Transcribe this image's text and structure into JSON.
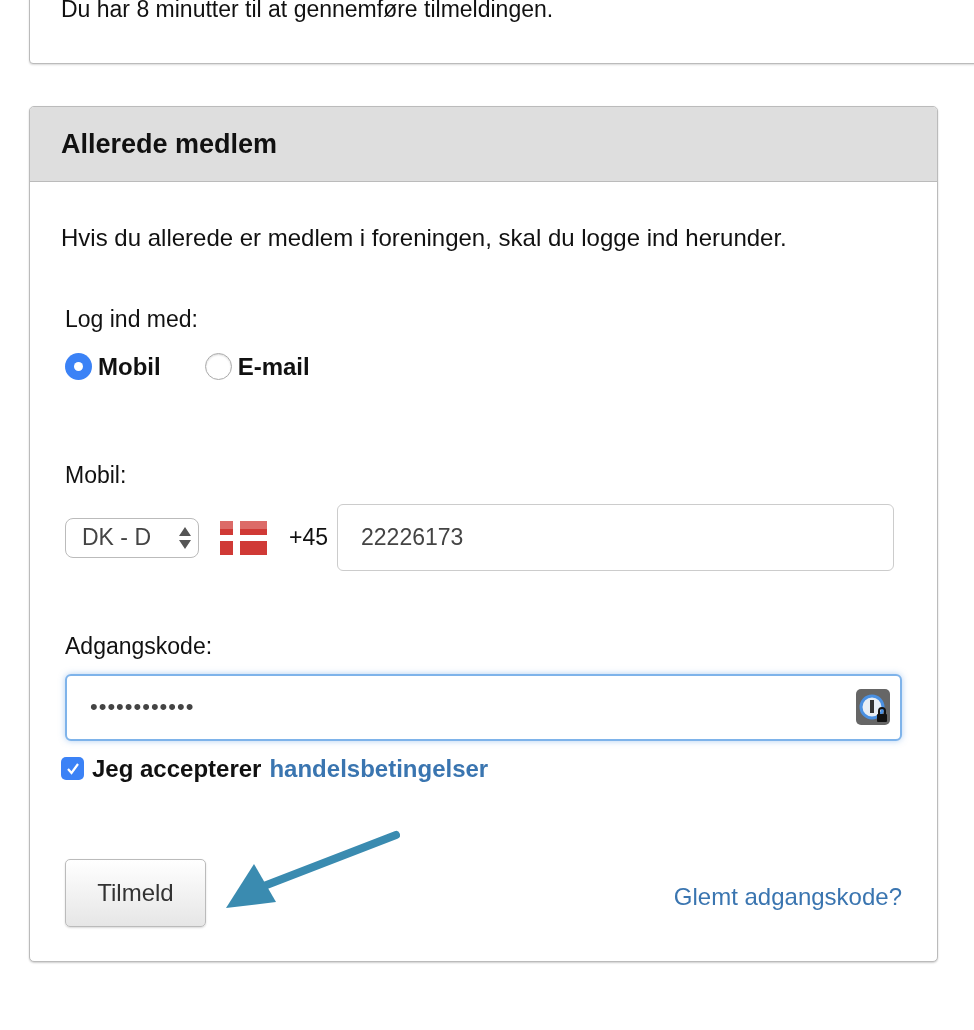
{
  "notice": {
    "text": "Du har 8 minutter til at gennemføre tilmeldingen."
  },
  "login_panel": {
    "title": "Allerede medlem",
    "intro": "Hvis du allerede er medlem i foreningen, skal du logge ind herunder.",
    "method_label": "Log ind med:",
    "methods": [
      {
        "label": "Mobil",
        "selected": true
      },
      {
        "label": "E-mail",
        "selected": false
      }
    ],
    "phone_label": "Mobil:",
    "country_select": {
      "value": "DK - D"
    },
    "dial_code": "+45",
    "phone_field": {
      "value": "22226173"
    },
    "password_label": "Adgangskode:",
    "password_field": {
      "value": "••••••••••••",
      "focused": true
    },
    "terms": {
      "checked": true,
      "text": "Jeg accepterer",
      "link": "handelsbetingelser"
    },
    "submit_button": "Tilmeld",
    "forgot_link": "Glemt adgangskode?"
  }
}
